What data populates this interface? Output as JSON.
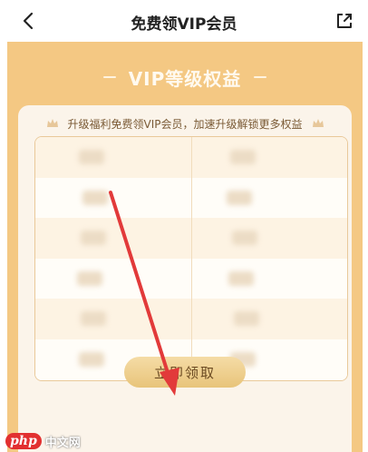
{
  "nav": {
    "title": "免费领VIP会员",
    "back_icon": "chevron-left-icon",
    "share_icon": "share-icon"
  },
  "section": {
    "heading": "VIP等级权益",
    "subtitle": "升级福利免费领VIP会员，加速升级解锁更多权益",
    "rows": 6
  },
  "actions": {
    "claim_label": "立即领取"
  },
  "watermark": {
    "logo": "php",
    "text": "中文网"
  },
  "colors": {
    "panel_bg": "#f4c883",
    "card_bg": "#fbf4ea",
    "button_bg": "#ecca86",
    "arrow": "#e23a3a"
  }
}
